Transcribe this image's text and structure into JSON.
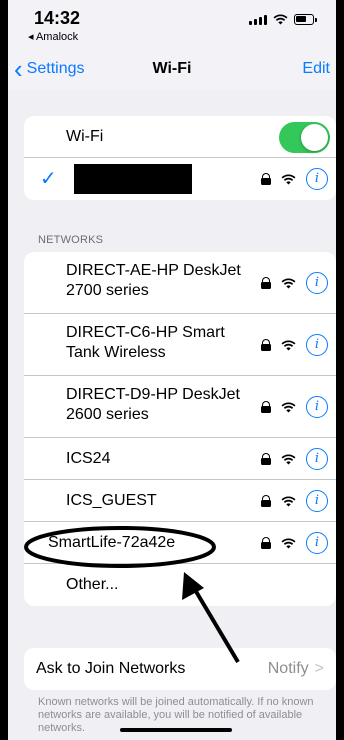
{
  "status_bar": {
    "time": "14:32",
    "back_app": "◂ Amalock"
  },
  "nav": {
    "back_label": "Settings",
    "title": "Wi-Fi",
    "edit_label": "Edit"
  },
  "wifi_toggle": {
    "label": "Wi-Fi",
    "on": true
  },
  "connected": {
    "checkmark": "✓",
    "name_redacted": true
  },
  "networks": {
    "header": "NETWORKS",
    "items": [
      {
        "name": "DIRECT-AE-HP DeskJet\n2700 series",
        "line1": "DIRECT-AE-HP DeskJet",
        "line2": "2700 series"
      },
      {
        "name": "DIRECT-C6-HP Smart\nTank Wireless",
        "line1": "DIRECT-C6-HP Smart",
        "line2": "Tank Wireless"
      },
      {
        "name": "DIRECT-D9-HP DeskJet\n2600 series",
        "line1": "DIRECT-D9-HP DeskJet",
        "line2": "2600 series"
      },
      {
        "name": "ICS24"
      },
      {
        "name": "ICS_GUEST"
      },
      {
        "name": "SmartLife-72a42e"
      }
    ],
    "other_label": "Other..."
  },
  "ask_join": {
    "label": "Ask to Join Networks",
    "value": "Notify",
    "chevron": ">",
    "footnote": "Known networks will be joined automatically. If no known networks are available, you will be notified of available networks."
  },
  "icons": {
    "info_glyph": "i"
  },
  "colors": {
    "accent": "#0a7aff",
    "toggle_on": "#34c759"
  }
}
